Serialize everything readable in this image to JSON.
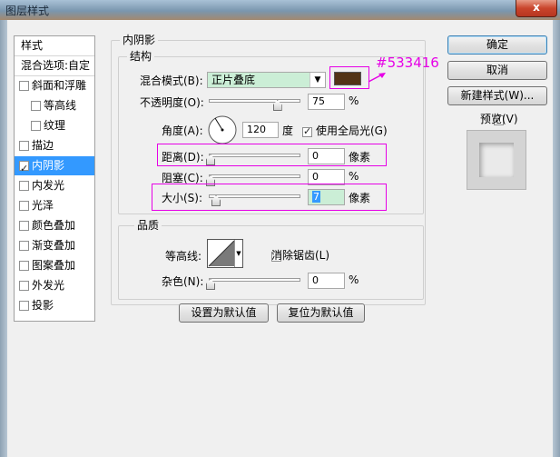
{
  "window": {
    "title": "图层样式",
    "close_label": "x"
  },
  "style_list": {
    "header": "样式",
    "blend_options": "混合选项:自定",
    "items": [
      {
        "label": "斜面和浮雕",
        "checked": false,
        "indent": false
      },
      {
        "label": "等高线",
        "checked": false,
        "indent": true
      },
      {
        "label": "纹理",
        "checked": false,
        "indent": true
      },
      {
        "label": "描边",
        "checked": false,
        "indent": false
      },
      {
        "label": "内阴影",
        "checked": true,
        "indent": false,
        "selected": true
      },
      {
        "label": "内发光",
        "checked": false,
        "indent": false
      },
      {
        "label": "光泽",
        "checked": false,
        "indent": false
      },
      {
        "label": "颜色叠加",
        "checked": false,
        "indent": false
      },
      {
        "label": "渐变叠加",
        "checked": false,
        "indent": false
      },
      {
        "label": "图案叠加",
        "checked": false,
        "indent": false
      },
      {
        "label": "外发光",
        "checked": false,
        "indent": false
      },
      {
        "label": "投影",
        "checked": false,
        "indent": false
      }
    ]
  },
  "panel": {
    "title": "内阴影",
    "structure": {
      "title": "结构",
      "blend_mode_label": "混合模式(B):",
      "blend_mode_value": "正片叠底",
      "color_hex": "#533416",
      "color_annotation": "#533416",
      "opacity_label": "不透明度(O):",
      "opacity_value": "75",
      "opacity_unit": "%",
      "opacity_level": 0.75,
      "angle_label": "角度(A):",
      "angle_value": "120",
      "angle_unit": "度",
      "global_light_label": "使用全局光(G)",
      "global_light_checked": true,
      "distance_label": "距离(D):",
      "distance_value": "0",
      "distance_unit": "像素",
      "choke_label": "阻塞(C):",
      "choke_value": "0",
      "choke_unit": "%",
      "size_label": "大小(S):",
      "size_value": "7",
      "size_unit": "像素"
    },
    "quality": {
      "title": "品质",
      "contour_label": "等高线:",
      "anti_alias_label": "消除锯齿(L)",
      "anti_alias_checked": false,
      "noise_label": "杂色(N):",
      "noise_value": "0",
      "noise_unit": "%"
    },
    "buttons": {
      "make_default": "设置为默认值",
      "reset_default": "复位为默认值"
    }
  },
  "right": {
    "ok": "确定",
    "cancel": "取消",
    "new_style": "新建样式(W)...",
    "preview_label": "预览(V)",
    "preview_checked": true
  },
  "colors": {
    "annotation": "#e600e6",
    "selection": "#3399ff",
    "field_highlight": "#cbeed6"
  }
}
